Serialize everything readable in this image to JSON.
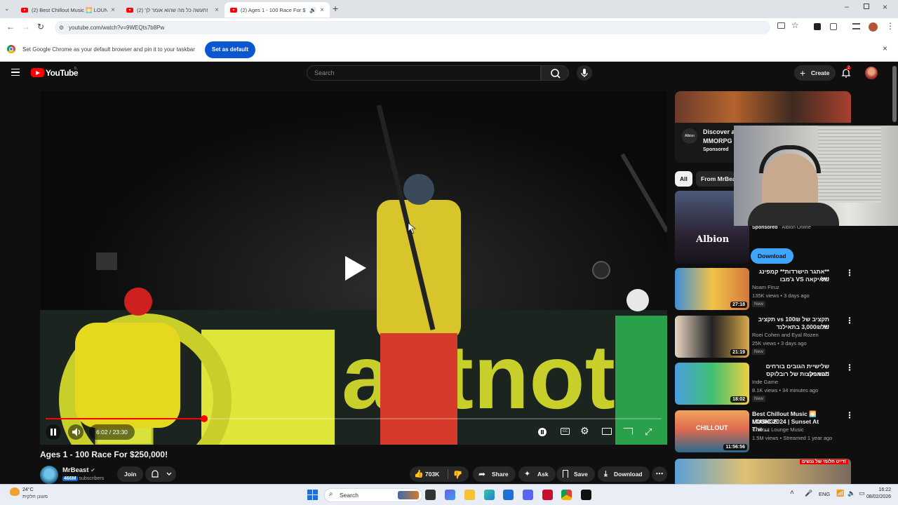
{
  "browser": {
    "tabs": [
      {
        "title": "(2) Best Chillout Music 🌅 LOUNGE",
        "active": false
      },
      {
        "title": "(2) תעשה כל מה שהוא אומר לך!",
        "active": false
      },
      {
        "title": "(2) Ages 1 - 100 Race For $",
        "active": true
      }
    ],
    "url": "youtube.com/watch?v=9WEQts7b8Pw",
    "infobar_text": "Set Google Chrome as your default browser and pin it to your taskbar",
    "infobar_button": "Set as default"
  },
  "youtube": {
    "logo_text": "YouTube",
    "logo_superscript": "IL",
    "search_placeholder": "Search",
    "create_label": "Create",
    "notification_count": "2",
    "player": {
      "time": "6:02 / 23:30",
      "progress_fraction": 0.257
    },
    "video_title": "Ages 1 - 100 Race For $250,000!",
    "channel": {
      "name": "MrBeast",
      "subs_count": "466M",
      "subs_suffix": "subscribers",
      "join_label": "Join"
    },
    "actions": {
      "likes": "703K",
      "share": "Share",
      "ask": "Ask",
      "save": "Save",
      "download": "Download"
    },
    "ad": {
      "title": "Discover a",
      "subtitle": "MMORPG",
      "sponsored": "Sponsored"
    },
    "chips": [
      "All",
      "From MrBea"
    ],
    "albion": {
      "sponsored": "Sponsored",
      "advertiser": "Albion Online",
      "button": "Download",
      "logo": "Albion"
    },
    "recommendations": [
      {
        "title1": "**אתגר הישרדות** קמפינג של",
        "title2": "!!!איקאה VS ג'מבו",
        "channel": "Noam Firuz",
        "meta": "135K views • 3 days ago",
        "badge": "New",
        "duration": "27:18"
      },
      {
        "title1": "תקציב של 100₪ vs תקציב של",
        "title2": "!!! 3,000₪ בתאילנד",
        "channel": "Roei Cohen and Eyal Rozen",
        "meta": "25K views • 3 days ago",
        "badge": "New",
        "duration": "21:19"
      },
      {
        "title1": "שלישיית הגובים בורחים מפארק",
        "title2": "!!המפלצות של רובלוקס",
        "channel": "Inde Game",
        "meta": "8.1K views • 34 minutes ago",
        "badge": "New",
        "duration": "18:02"
      },
      {
        "title1": "Best Chillout Music 🌅 LOUNGE",
        "title2": "MUSIC 2024 | Sunset At The ...",
        "channel": "Chillout Lounge Music",
        "meta": "1.5M views • Streamed 1 year ago",
        "badge": "",
        "duration": "11:56:56"
      }
    ],
    "chillout_thumb_text": "CHILLOUT",
    "last_thumb_text": "דייט חלומי של גנשים!"
  },
  "taskbar": {
    "weather_temp": "24°C",
    "weather_desc": "מעונן חלקית",
    "search": "Search",
    "lang": "ENG",
    "time": "16:22",
    "date": "08/02/2026"
  },
  "colors": {
    "youtube_red": "#ff0000",
    "bg": "#0f0f0f",
    "chrome_blue": "#0b57d0"
  }
}
